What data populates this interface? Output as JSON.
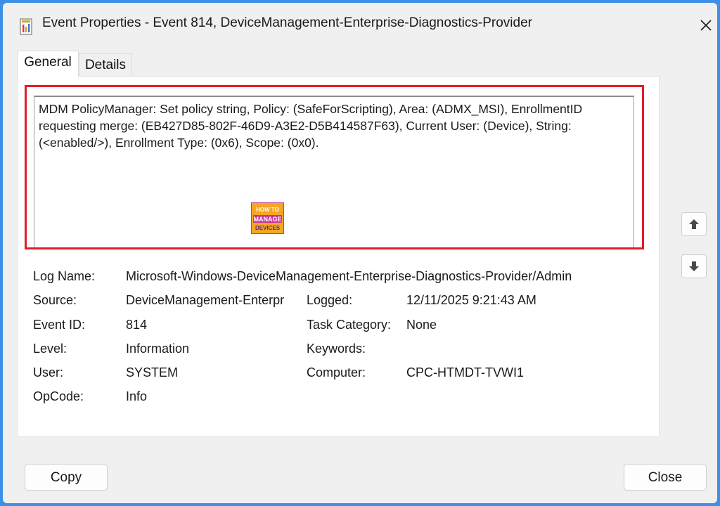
{
  "window": {
    "title": "Event Properties - Event 814, DeviceManagement-Enterprise-Diagnostics-Provider",
    "icon": "event-viewer-icon"
  },
  "tabs": [
    {
      "label": "General",
      "selected": true
    },
    {
      "label": "Details",
      "selected": false
    }
  ],
  "description": "MDM PolicyManager: Set policy string, Policy: (SafeForScripting), Area: (ADMX_MSI), EnrollmentID requesting merge: (EB427D85-802F-46D9-A3E2-D5B414587F63), Current User: (Device), String: (<enabled/>), Enrollment Type: (0x6), Scope: (0x0).",
  "watermark": {
    "line1": "HOW TO",
    "line2": "MANAGE",
    "line3": "DEVICES"
  },
  "fields": {
    "log_name": {
      "label": "Log Name:",
      "value": "Microsoft-Windows-DeviceManagement-Enterprise-Diagnostics-Provider/Admin"
    },
    "source": {
      "label": "Source:",
      "value": "DeviceManagement-Enterpr"
    },
    "logged": {
      "label": "Logged:",
      "value": "12/11/2025 9:21:43 AM"
    },
    "event_id": {
      "label": "Event ID:",
      "value": "814"
    },
    "task_category": {
      "label": "Task Category:",
      "value": "None"
    },
    "level": {
      "label": "Level:",
      "value": "Information"
    },
    "keywords": {
      "label": "Keywords:",
      "value": ""
    },
    "user": {
      "label": "User:",
      "value": "SYSTEM"
    },
    "computer": {
      "label": "Computer:",
      "value": "CPC-HTMDT-TVWI1"
    },
    "opcode": {
      "label": "OpCode:",
      "value": "Info"
    }
  },
  "buttons": {
    "copy": "Copy",
    "close": "Close"
  },
  "colors": {
    "highlight": "#e21b2a",
    "background": "#3b8fe6"
  }
}
